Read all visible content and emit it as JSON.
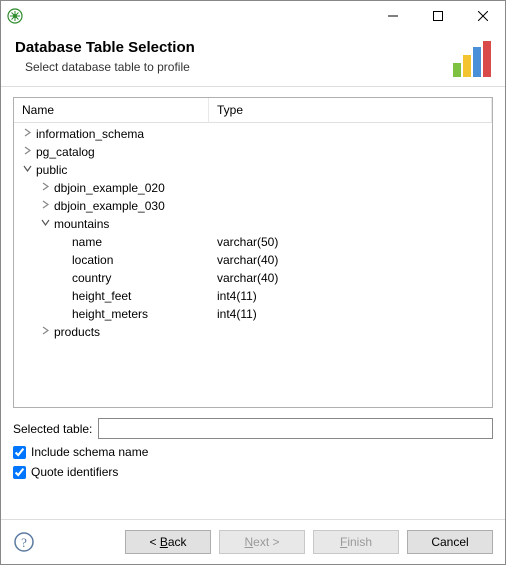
{
  "header": {
    "title": "Database Table Selection",
    "subtitle": "Select database table to profile"
  },
  "columns": {
    "name": "Name",
    "type": "Type"
  },
  "tree": [
    {
      "depth": 0,
      "expand": "closed",
      "name": "information_schema",
      "type": ""
    },
    {
      "depth": 0,
      "expand": "closed",
      "name": "pg_catalog",
      "type": ""
    },
    {
      "depth": 0,
      "expand": "open",
      "name": "public",
      "type": ""
    },
    {
      "depth": 1,
      "expand": "closed",
      "name": "dbjoin_example_020",
      "type": ""
    },
    {
      "depth": 1,
      "expand": "closed",
      "name": "dbjoin_example_030",
      "type": ""
    },
    {
      "depth": 1,
      "expand": "open",
      "name": "mountains",
      "type": ""
    },
    {
      "depth": 2,
      "expand": "none",
      "name": "name",
      "type": "varchar(50)"
    },
    {
      "depth": 2,
      "expand": "none",
      "name": "location",
      "type": "varchar(40)"
    },
    {
      "depth": 2,
      "expand": "none",
      "name": "country",
      "type": "varchar(40)"
    },
    {
      "depth": 2,
      "expand": "none",
      "name": "height_feet",
      "type": "int4(11)"
    },
    {
      "depth": 2,
      "expand": "none",
      "name": "height_meters",
      "type": "int4(11)"
    },
    {
      "depth": 1,
      "expand": "closed",
      "name": "products",
      "type": ""
    }
  ],
  "selected_table": {
    "label": "Selected table:",
    "value": ""
  },
  "checks": {
    "include_schema": {
      "label": "Include schema name",
      "checked": true
    },
    "quote_identifiers": {
      "label": "Quote identifiers",
      "checked": true
    }
  },
  "buttons": {
    "back_prefix": "< ",
    "back_u": "B",
    "back_rest": "ack",
    "next_u": "N",
    "next_rest": "ext >",
    "finish_pre": "",
    "finish_u": "F",
    "finish_rest": "inish",
    "cancel": "Cancel"
  }
}
